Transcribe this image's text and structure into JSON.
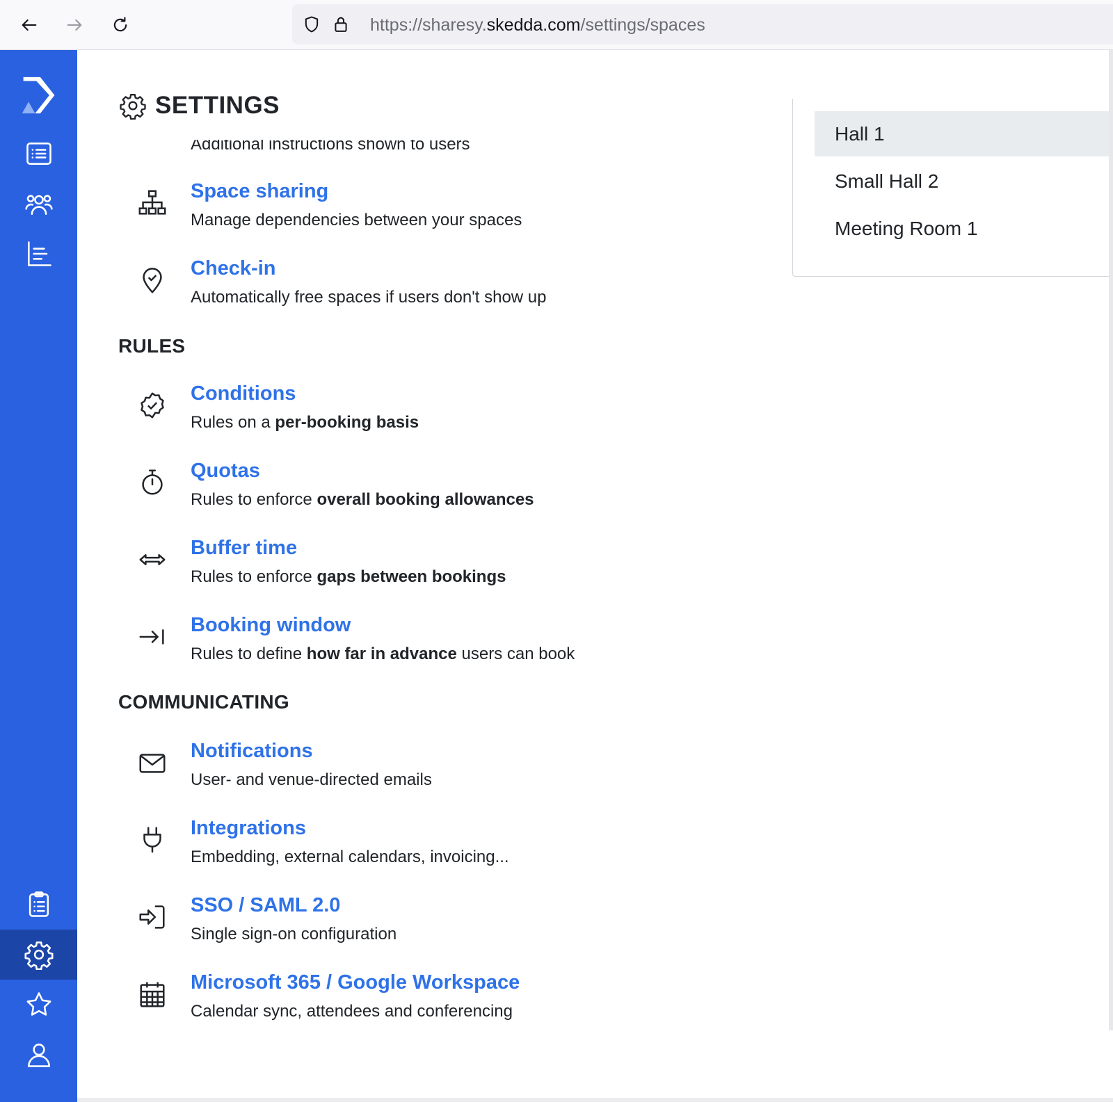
{
  "browser": {
    "url_prefix": "https://sharesy.",
    "url_domain": "skedda.com",
    "url_path": "/settings/spaces"
  },
  "sidebar": {
    "items": [
      {
        "icon": "skedda-logo"
      },
      {
        "icon": "list-icon"
      },
      {
        "icon": "users-icon"
      },
      {
        "icon": "chart-icon"
      },
      {
        "icon": "clipboard-icon"
      },
      {
        "icon": "gear-icon",
        "active": true
      },
      {
        "icon": "star-icon"
      },
      {
        "icon": "user-icon"
      }
    ],
    "accent": "#2a61e0",
    "active_bg": "#1c45a8"
  },
  "page": {
    "title": "SETTINGS",
    "partial_desc": "Additional instructions shown to users"
  },
  "sections": {
    "space": {
      "items": [
        {
          "title": "Space sharing",
          "desc": "Manage dependencies between your spaces",
          "icon": "hierarchy-icon"
        },
        {
          "title": "Check-in",
          "desc": "Automatically free spaces if users don't show up",
          "icon": "location-pin-icon"
        }
      ]
    },
    "rules": {
      "heading": "RULES",
      "items": [
        {
          "title": "Conditions",
          "desc_pre": "Rules on a ",
          "desc_bold": "per-booking basis",
          "desc_post": "",
          "icon": "badge-check-icon"
        },
        {
          "title": "Quotas",
          "desc_pre": "Rules to enforce ",
          "desc_bold": "overall booking allowances",
          "desc_post": "",
          "icon": "stopwatch-icon"
        },
        {
          "title": "Buffer time",
          "desc_pre": "Rules to enforce ",
          "desc_bold": "gaps between bookings",
          "desc_post": "",
          "icon": "arrows-horizontal-icon"
        },
        {
          "title": "Booking window",
          "desc_pre": "Rules to define ",
          "desc_bold": "how far in advance",
          "desc_post": " users can book",
          "icon": "arrow-to-line-icon"
        }
      ]
    },
    "communicating": {
      "heading": "COMMUNICATING",
      "items": [
        {
          "title": "Notifications",
          "desc": "User- and venue-directed emails",
          "icon": "envelope-icon"
        },
        {
          "title": "Integrations",
          "desc": "Embedding, external calendars, invoicing...",
          "icon": "plug-icon"
        },
        {
          "title": "SSO / SAML 2.0",
          "desc": "Single sign-on configuration",
          "icon": "sign-in-icon"
        },
        {
          "title": "Microsoft 365 / Google Workspace",
          "desc": "Calendar sync, attendees and conferencing",
          "icon": "calendar-icon"
        }
      ]
    }
  },
  "dropdown": {
    "options": [
      "Hall 1",
      "Small Hall 2",
      "Meeting Room 1"
    ],
    "selected": "Hall 1"
  },
  "colors": {
    "link": "#2f72e8",
    "text": "#212529"
  }
}
